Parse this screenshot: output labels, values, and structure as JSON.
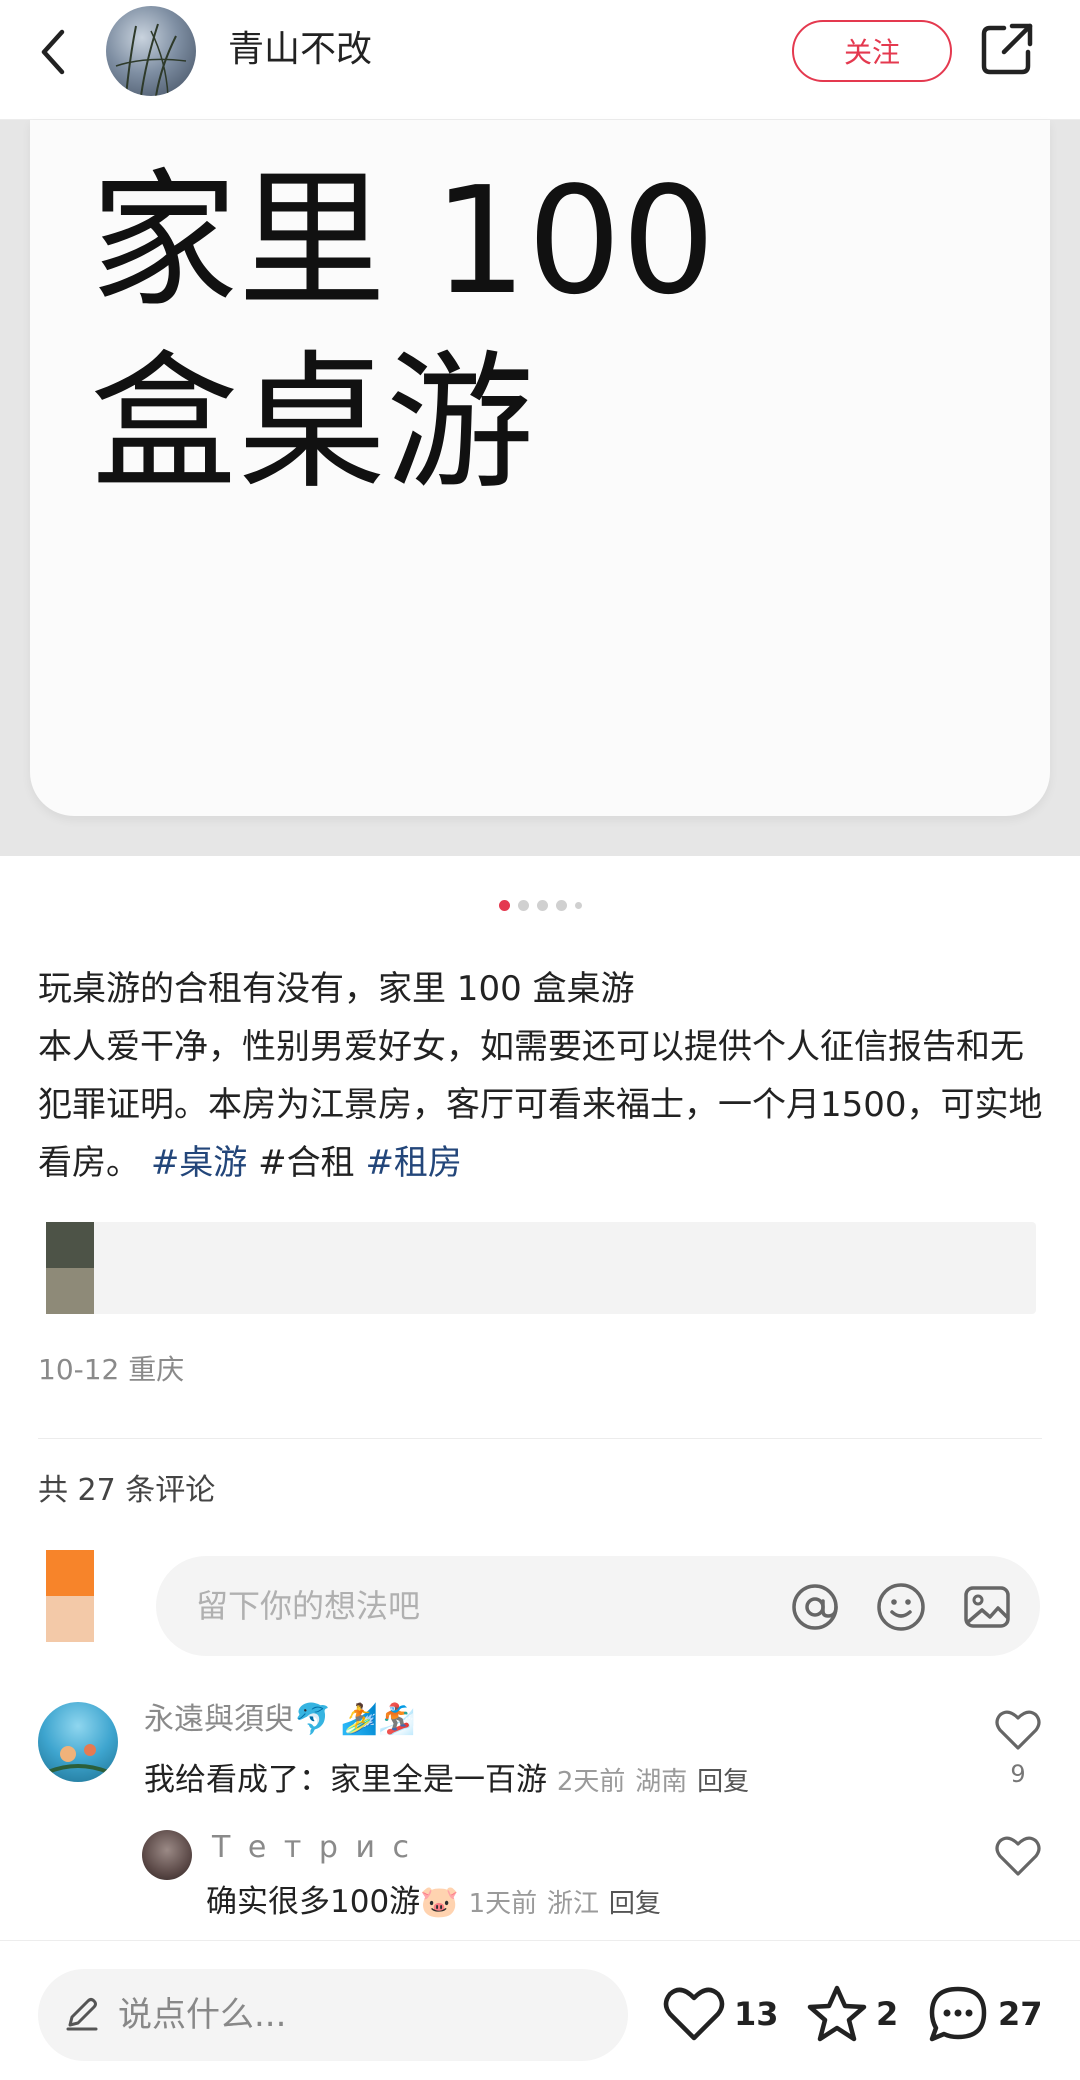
{
  "header": {
    "author_name": "青山不改",
    "follow_label": "关注"
  },
  "media": {
    "line1": "家里 100",
    "line2": "盒桌游",
    "page_count": 5,
    "current_page": 1
  },
  "post": {
    "title_line": "玩桌游的合租有没有，家里 100 盒桌游",
    "body": "本人爱干净，性别男爱好女，如需要还可以提供个人征信报告和无犯罪证明。本房为江景房，客厅可看来福士，一个月1500，可实地看房。",
    "tags": [
      "#桌游",
      "#合租",
      "#租房"
    ],
    "meta": "10-12 重庆"
  },
  "comments_section": {
    "count_label": "共 27 条评论",
    "input_placeholder": "留下你的想法吧"
  },
  "comments": [
    {
      "author": "永遠與須臾🐬 🏄🏂",
      "text": "我给看成了：家里全是一百游",
      "time": "2天前",
      "location": "湖南",
      "reply_label": "回复",
      "likes": "9"
    },
    {
      "author": "Т е т р и с",
      "text": "确实很多100游🐷",
      "time": "1天前",
      "location": "浙江",
      "reply_label": "回复",
      "likes": ""
    }
  ],
  "bottom_bar": {
    "input_placeholder": "说点什么...",
    "like_count": "13",
    "collect_count": "2",
    "comment_count": "27"
  },
  "colors": {
    "accent": "#e4394f",
    "tag": "#23467a"
  }
}
